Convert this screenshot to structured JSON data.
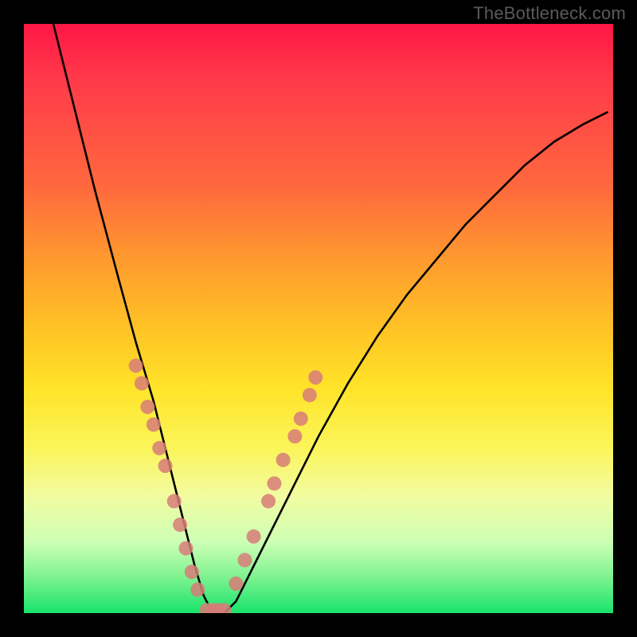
{
  "attribution": "TheBottleneck.com",
  "chart_data": {
    "type": "line",
    "title": "",
    "xlabel": "",
    "ylabel": "",
    "xlim": [
      0,
      100
    ],
    "ylim": [
      0,
      100
    ],
    "grid": false,
    "series": [
      {
        "name": "curve",
        "stroke": "#000000",
        "x": [
          5,
          8,
          12,
          16,
          19,
          22,
          24,
          26,
          27.5,
          29,
          30.5,
          32,
          34,
          36,
          40,
          45,
          50,
          55,
          60,
          65,
          70,
          75,
          80,
          85,
          90,
          95,
          99
        ],
        "y": [
          100,
          88,
          72,
          57,
          46,
          36,
          28,
          20,
          14,
          8,
          3,
          0,
          0,
          2,
          10,
          20,
          30,
          39,
          47,
          54,
          60,
          66,
          71,
          76,
          80,
          83,
          85
        ]
      }
    ],
    "markers": [
      {
        "name": "left-descending-dots",
        "color": "#d77d78",
        "points": [
          {
            "x": 19.0,
            "y": 42
          },
          {
            "x": 20.0,
            "y": 39
          },
          {
            "x": 21.0,
            "y": 35
          },
          {
            "x": 22.0,
            "y": 32
          },
          {
            "x": 23.0,
            "y": 28
          },
          {
            "x": 24.0,
            "y": 25
          },
          {
            "x": 25.5,
            "y": 19
          },
          {
            "x": 26.5,
            "y": 15
          },
          {
            "x": 27.5,
            "y": 11
          },
          {
            "x": 28.5,
            "y": 7
          },
          {
            "x": 29.5,
            "y": 4
          }
        ]
      },
      {
        "name": "bottom-trough-dots",
        "color": "#d77d78",
        "points": [
          {
            "x": 31,
            "y": 0.5
          },
          {
            "x": 32,
            "y": 0.5
          },
          {
            "x": 33,
            "y": 0.5
          },
          {
            "x": 34,
            "y": 0.5
          }
        ]
      },
      {
        "name": "right-ascending-dots",
        "color": "#d77d78",
        "points": [
          {
            "x": 36.0,
            "y": 5
          },
          {
            "x": 37.5,
            "y": 9
          },
          {
            "x": 39.0,
            "y": 13
          },
          {
            "x": 41.5,
            "y": 19
          },
          {
            "x": 42.5,
            "y": 22
          },
          {
            "x": 44.0,
            "y": 26
          },
          {
            "x": 46.0,
            "y": 30
          },
          {
            "x": 47.0,
            "y": 33
          },
          {
            "x": 48.5,
            "y": 37
          },
          {
            "x": 49.5,
            "y": 40
          }
        ]
      }
    ]
  }
}
